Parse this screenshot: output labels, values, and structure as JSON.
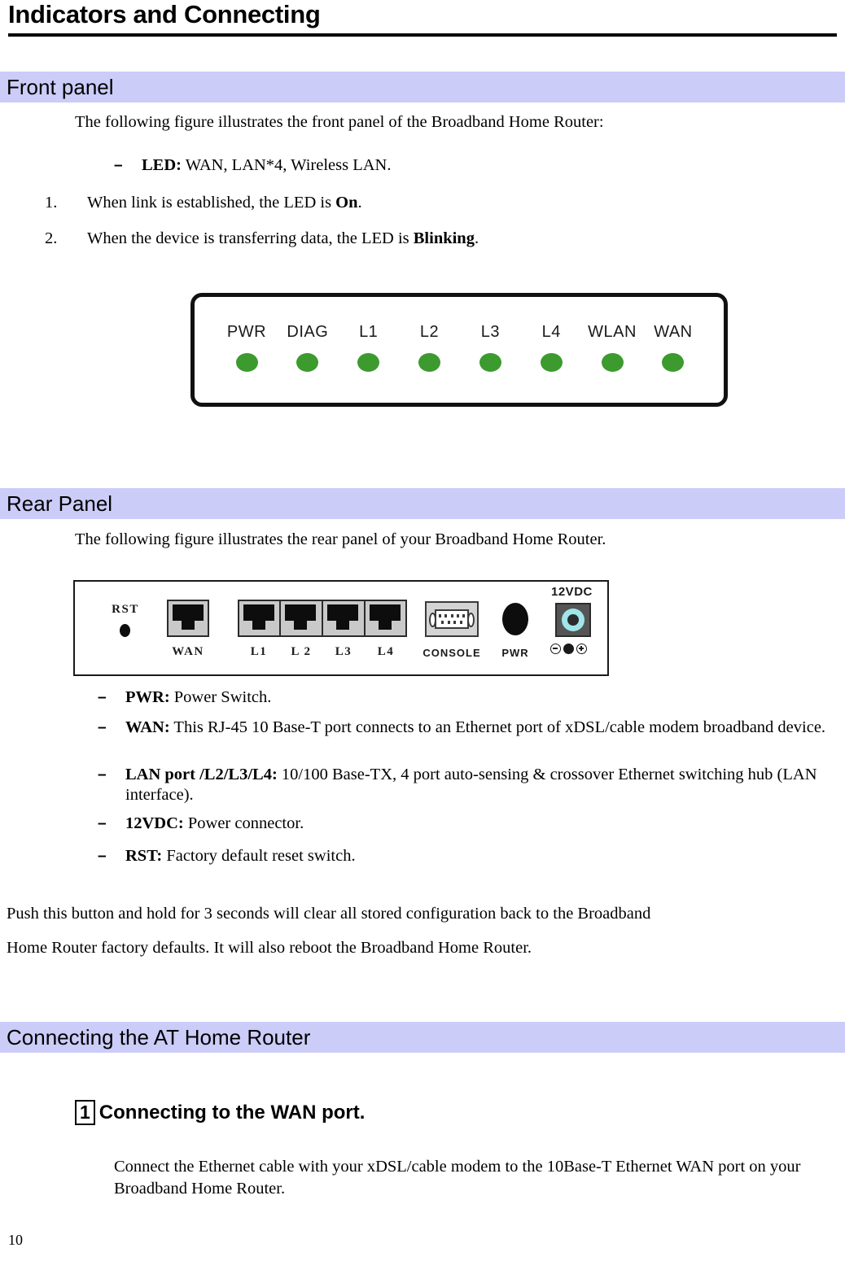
{
  "document": {
    "title": "Indicators and Connecting",
    "page_number": "10"
  },
  "sections": {
    "front_panel": {
      "heading": "Front panel",
      "intro": "The following figure illustrates the front panel of the Broadband Home Router:",
      "dash_items": [
        {
          "bullet": "–",
          "label": "LED:",
          "text": " WAN, LAN*4, Wireless LAN."
        }
      ],
      "numbered_items": [
        {
          "number": "1.",
          "text_before": "When link is established, the LED is ",
          "bold": "On",
          "text_after": "."
        },
        {
          "number": "2.",
          "text_before": "When the device is transferring data, the LED is ",
          "bold": "Blinking",
          "text_after": "."
        }
      ],
      "figure": {
        "name": "front-panel-diagram",
        "leds": [
          {
            "label": "PWR",
            "color": "#3c9a2e"
          },
          {
            "label": "DIAG",
            "color": "#3c9a2e"
          },
          {
            "label": "L1",
            "color": "#3c9a2e"
          },
          {
            "label": "L2",
            "color": "#3c9a2e"
          },
          {
            "label": "L3",
            "color": "#3c9a2e"
          },
          {
            "label": "L4",
            "color": "#3c9a2e"
          },
          {
            "label": "WLAN",
            "color": "#3c9a2e"
          },
          {
            "label": "WAN",
            "color": "#3c9a2e"
          }
        ]
      }
    },
    "rear_panel": {
      "heading": "Rear Panel",
      "intro": "The following figure illustrates the rear panel of your Broadband Home Router.",
      "figure": {
        "name": "rear-panel-diagram",
        "reset_label": "RST",
        "wan_label": "WAN",
        "lan_labels": [
          "L1",
          "L 2",
          "L3",
          "L4"
        ],
        "console_label": "CONSOLE",
        "power_switch_label": "PWR",
        "dc_label": "12VDC"
      },
      "dash_items": [
        {
          "bullet": "–",
          "label": "PWR:",
          "text": " Power Switch."
        },
        {
          "bullet": "–",
          "label": "WAN:",
          "text": " This RJ-45 10 Base-T port connects to an Ethernet port of xDSL/cable modem broadband device."
        },
        {
          "bullet": "–",
          "label": "LAN port /L2/L3/L4:",
          "text": " 10/100 Base-TX, 4 port auto-sensing & crossover Ethernet switching hub (LAN interface)."
        },
        {
          "bullet": "–",
          "label": "12VDC:",
          "text": " Power connector."
        },
        {
          "bullet": "–",
          "label": "RST:",
          "text": " Factory default reset switch."
        }
      ],
      "note_line_1": "Push this button and hold for 3 seconds will clear all stored configuration back to the Broadband",
      "note_line_2": "Home Router factory defaults. It will also reboot the Broadband Home Router."
    },
    "connecting": {
      "heading": "Connecting the AT Home Router",
      "step": {
        "number": "1",
        "title": "Connecting to the WAN port.",
        "body": "Connect the Ethernet cable with your xDSL/cable modem to the 10Base-T Ethernet WAN port on your Broadband Home Router."
      }
    }
  },
  "colors": {
    "section_bar_background": "#ccccf9",
    "led_green": "#3c9a2e",
    "dc_jack_ring": "#9fe6ea"
  }
}
